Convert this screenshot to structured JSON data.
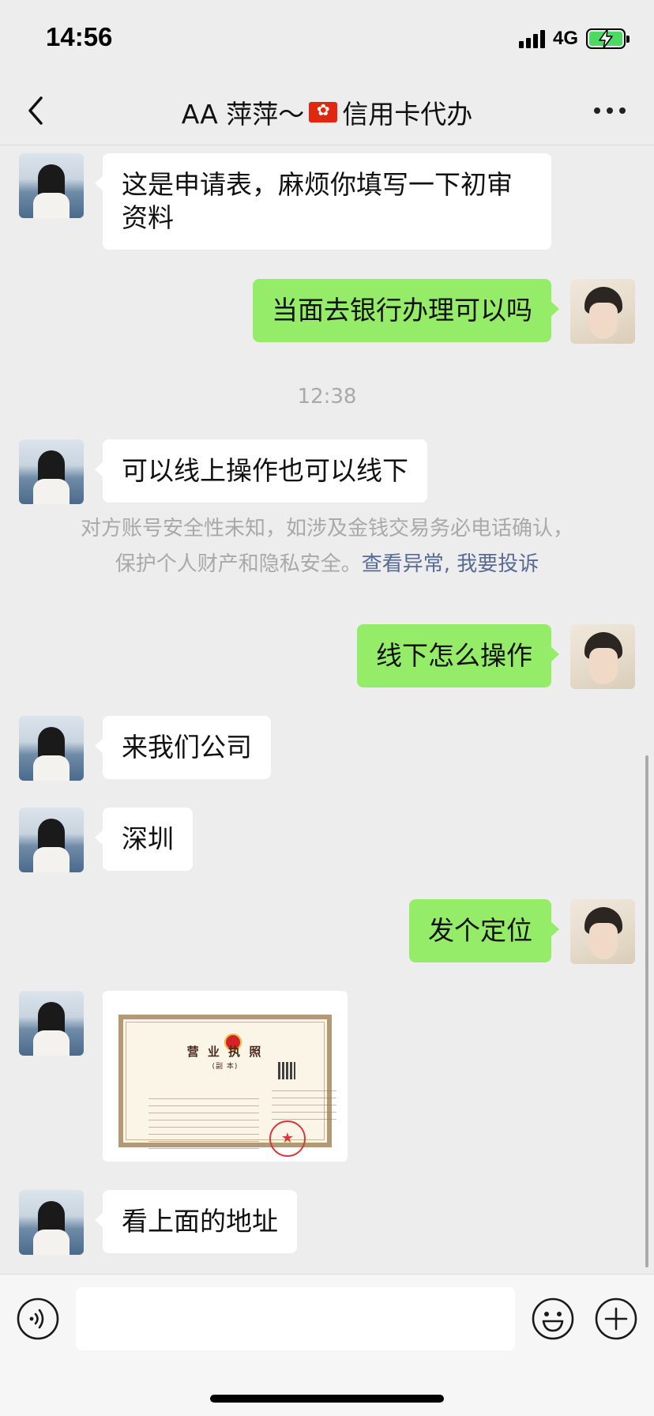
{
  "status_bar": {
    "time": "14:56",
    "network": "4G",
    "battery_state": "charging",
    "signal_bars": 4
  },
  "nav": {
    "title_prefix": "AA 萍萍～",
    "flag_icon": "hong-kong-flag-icon",
    "title_suffix": "信用卡代办",
    "back_icon": "chevron-left-icon",
    "more_icon": "more-dots-icon"
  },
  "messages": [
    {
      "side": "left",
      "text_lines": [
        "这是申请表，麻烦你填写一下初审",
        "资料"
      ]
    },
    {
      "side": "right",
      "text": "当面去银行办理可以吗"
    },
    {
      "type": "timestamp",
      "text": "12:38"
    },
    {
      "side": "left",
      "text": "可以线上操作也可以线下"
    },
    {
      "type": "system",
      "line1": "对方账号安全性未知，如涉及金钱交易务必电话确认，",
      "line2_prefix": "保护个人财产和隐私安全。",
      "link_abnormal": "查看异常",
      "separator": ",",
      "link_complain": "我要投诉"
    },
    {
      "side": "right",
      "text": "线下怎么操作"
    },
    {
      "side": "left",
      "text": "来我们公司"
    },
    {
      "side": "left",
      "text": "深圳"
    },
    {
      "side": "right",
      "text": "发个定位"
    },
    {
      "side": "left",
      "type": "image",
      "image_title": "营 业 执 照",
      "image_subtitle": "(副 本)",
      "image_icon": "business-license-image"
    },
    {
      "side": "left",
      "text": "看上面的地址"
    }
  ],
  "input_bar": {
    "voice_icon": "voice-icon",
    "input_value": "",
    "emoji_icon": "emoji-icon",
    "add_icon": "plus-circle-icon"
  },
  "colors": {
    "background": "#ededed",
    "bubble_self": "#95ec69",
    "bubble_other": "#ffffff",
    "link": "#576b95",
    "muted_text": "#a9a9a9",
    "battery": "#4cd964"
  }
}
